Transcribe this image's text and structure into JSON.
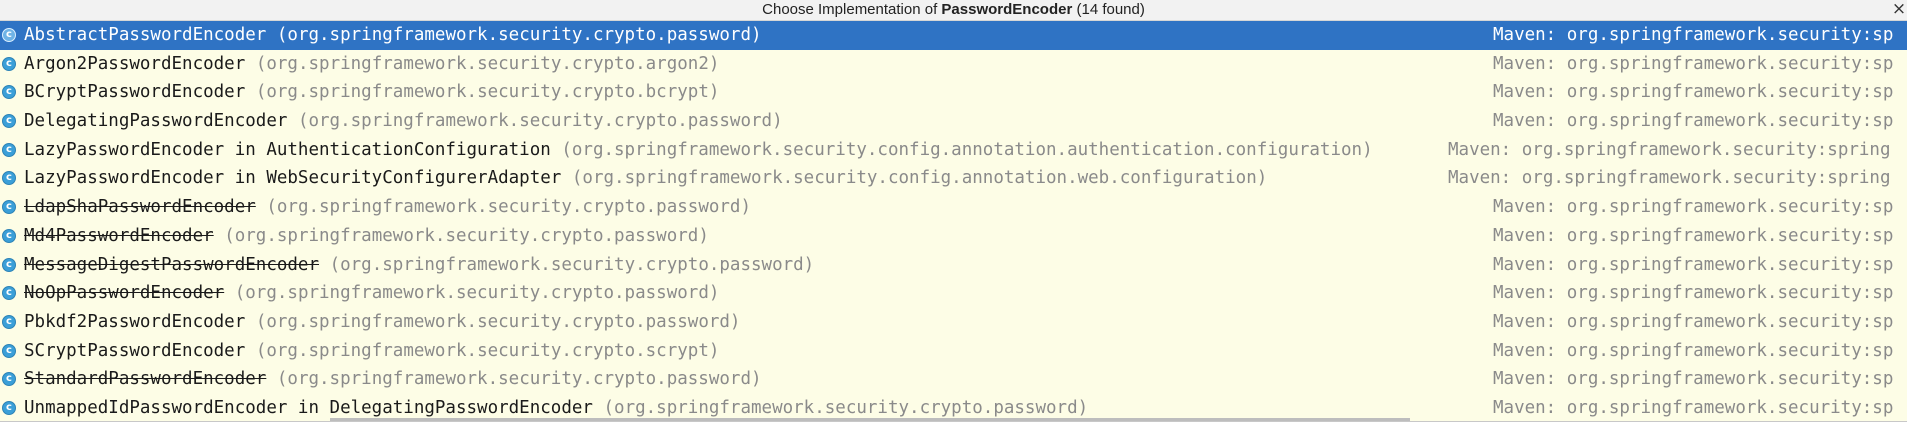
{
  "dialog": {
    "title_prefix": "Choose Implementation of ",
    "title_bold": "PasswordEncoder",
    "title_suffix": " (14 found)",
    "close_glyph": "×",
    "class_icon_letter": "c"
  },
  "implementations": [
    {
      "name": "AbstractPasswordEncoder",
      "pkg": "(org.springframework.security.crypto.password)",
      "maven": "Maven: org.springframework.security:sp",
      "deprecated": false
    },
    {
      "name": "Argon2PasswordEncoder",
      "pkg": "(org.springframework.security.crypto.argon2)",
      "maven": "Maven: org.springframework.security:sp",
      "deprecated": false
    },
    {
      "name": "BCryptPasswordEncoder",
      "pkg": "(org.springframework.security.crypto.bcrypt)",
      "maven": "Maven: org.springframework.security:sp",
      "deprecated": false
    },
    {
      "name": "DelegatingPasswordEncoder",
      "pkg": "(org.springframework.security.crypto.password)",
      "maven": "Maven: org.springframework.security:sp",
      "deprecated": false
    },
    {
      "name": "LazyPasswordEncoder in AuthenticationConfiguration",
      "pkg": "(org.springframework.security.config.annotation.authentication.configuration)",
      "maven": "Maven: org.springframework.security:spring",
      "deprecated": false
    },
    {
      "name": "LazyPasswordEncoder in WebSecurityConfigurerAdapter",
      "pkg": "(org.springframework.security.config.annotation.web.configuration)",
      "maven": "Maven: org.springframework.security:spring",
      "deprecated": false
    },
    {
      "name": "LdapShaPasswordEncoder",
      "pkg": "(org.springframework.security.crypto.password)",
      "maven": "Maven: org.springframework.security:sp",
      "deprecated": true
    },
    {
      "name": "Md4PasswordEncoder",
      "pkg": "(org.springframework.security.crypto.password)",
      "maven": "Maven: org.springframework.security:sp",
      "deprecated": true
    },
    {
      "name": "MessageDigestPasswordEncoder",
      "pkg": "(org.springframework.security.crypto.password)",
      "maven": "Maven: org.springframework.security:sp",
      "deprecated": true
    },
    {
      "name": "NoOpPasswordEncoder",
      "pkg": "(org.springframework.security.crypto.password)",
      "maven": "Maven: org.springframework.security:sp",
      "deprecated": true
    },
    {
      "name": "Pbkdf2PasswordEncoder",
      "pkg": "(org.springframework.security.crypto.password)",
      "maven": "Maven: org.springframework.security:sp",
      "deprecated": false
    },
    {
      "name": "SCryptPasswordEncoder",
      "pkg": "(org.springframework.security.crypto.scrypt)",
      "maven": "Maven: org.springframework.security:sp",
      "deprecated": false
    },
    {
      "name": "StandardPasswordEncoder",
      "pkg": "(org.springframework.security.crypto.password)",
      "maven": "Maven: org.springframework.security:sp",
      "deprecated": true
    },
    {
      "name": "UnmappedIdPasswordEncoder in DelegatingPasswordEncoder",
      "pkg": "(org.springframework.security.crypto.password)",
      "maven": "Maven: org.springframework.security:sp",
      "deprecated": false
    }
  ],
  "selected_index": 0,
  "colors": {
    "selection": "#2f73c4",
    "list_background": "#fdfde6",
    "class_icon": "#3b9fd8",
    "secondary_text": "#8a8a8a"
  }
}
